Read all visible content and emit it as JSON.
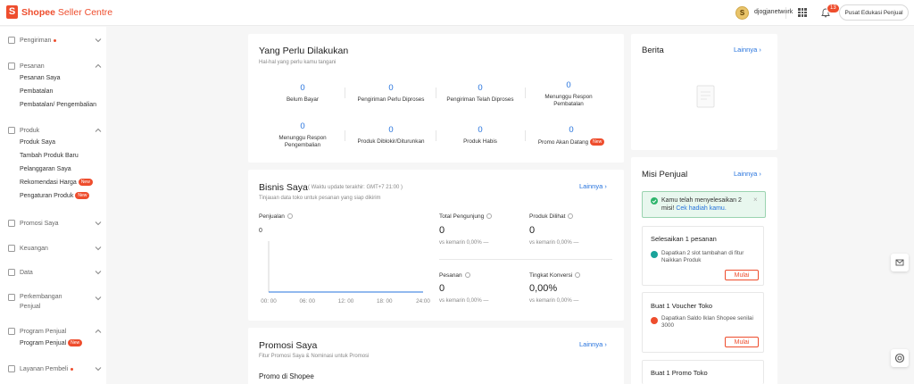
{
  "header": {
    "brand_logo_letter": "S",
    "brand_main": "Shopee",
    "brand_sub": "Seller Centre",
    "avatar_letter": "S",
    "username": "djogjanetwork",
    "notification_count": "13",
    "edu_button_label": "Pusat Edukasi Penjual"
  },
  "sidebar": {
    "groups": [
      {
        "label": "Pengiriman",
        "dot": true,
        "icon": "truck-icon",
        "items": []
      },
      {
        "label": "Pesanan",
        "icon": "clipboard-icon",
        "items": [
          {
            "label": "Pesanan Saya"
          },
          {
            "label": "Pembatalan"
          },
          {
            "label": "Pembatalan/ Pengembalian"
          }
        ]
      },
      {
        "label": "Produk",
        "icon": "box-icon",
        "items": [
          {
            "label": "Produk Saya"
          },
          {
            "label": "Tambah Produk Baru"
          },
          {
            "label": "Pelanggaran Saya"
          },
          {
            "label": "Rekomendasi Harga",
            "badge": "New"
          },
          {
            "label": "Pengaturan Produk",
            "badge": "New"
          }
        ]
      },
      {
        "label": "Promosi Saya",
        "icon": "tag-icon",
        "items": []
      },
      {
        "label": "Keuangan",
        "icon": "wallet-icon",
        "items": []
      },
      {
        "label": "Data",
        "icon": "chart-icon",
        "items": []
      },
      {
        "label": "Perkembangan Penjual",
        "icon": "growth-icon",
        "items": []
      },
      {
        "label": "Program Penjual",
        "icon": "program-icon",
        "items": [
          {
            "label": "Program Penjual",
            "badge": "New"
          }
        ]
      },
      {
        "label": "Layanan Pembeli",
        "dot": true,
        "icon": "headset-icon",
        "items": []
      }
    ]
  },
  "todo": {
    "title": "Yang Perlu Dilakukan",
    "subtitle": "Hal-hal yang perlu kamu tangani",
    "stats_row1": [
      {
        "value": "0",
        "label": "Belum Bayar"
      },
      {
        "value": "0",
        "label": "Pengiriman Perlu Diproses"
      },
      {
        "value": "0",
        "label": "Pengiriman Telah Diproses"
      },
      {
        "value": "0",
        "label": "Menunggu Respon Pembatalan"
      }
    ],
    "stats_row2": [
      {
        "value": "0",
        "label": "Menunggu Respon Pengembalian"
      },
      {
        "value": "0",
        "label": "Produk Diblokir/Diturunkan"
      },
      {
        "value": "0",
        "label": "Produk Habis"
      },
      {
        "value": "0",
        "label": "Promo Akan Datang",
        "badge": "New"
      }
    ]
  },
  "business": {
    "title": "Bisnis Saya",
    "update_note": "( Waktu update terakhir: GMT+7 21:00 )",
    "more_label": "Lainnya",
    "subtitle": "Tinjauan data toko untuk pesanan yang siap dikirim",
    "sales_label": "Penjualan",
    "metrics": [
      {
        "label": "Total Pengunjung",
        "value": "0",
        "sub": "vs kemarin 0,00% —"
      },
      {
        "label": "Produk Dilihat",
        "value": "0",
        "sub": "vs kemarin 0,00% —"
      },
      {
        "label": "Pesanan",
        "value": "0",
        "sub": "vs kemarin 0,00% —"
      },
      {
        "label": "Tingkat Konversi",
        "value": "0,00%",
        "sub": "vs kemarin 0,00% —"
      }
    ]
  },
  "chart_data": {
    "type": "line",
    "title": "",
    "xlabel": "",
    "ylabel": "",
    "categories": [
      "00: 00",
      "06: 00",
      "12: 00",
      "18: 00",
      "24:00"
    ],
    "values": [
      0,
      0,
      0,
      0,
      0
    ],
    "ytick": "0",
    "ylim": [
      0,
      1
    ],
    "grid": false,
    "line_color": "#2673dd"
  },
  "promo": {
    "title": "Promosi Saya",
    "more_label": "Lainnya",
    "subtitle": "Fitur Promosi Saya & Nominasi untuk Promosi",
    "section_label": "Promo di Shopee"
  },
  "news": {
    "title": "Berita",
    "more_label": "Lainnya"
  },
  "missions": {
    "title": "Misi Penjual",
    "more_label": "Lainnya",
    "success_text": "Kamu telah menyelesaikan 2 misi!",
    "success_link": "Cek hadiah kamu.",
    "items": [
      {
        "title": "Selesaikan 1 pesanan",
        "desc": "Dapatkan 2 slot tambahan di fitur Naikkan Produk",
        "button": "Mulai"
      },
      {
        "title": "Buat 1 Voucher Toko",
        "desc": "Dapatkan Saldo Iklan Shopee senilai 3000",
        "button": "Mulai"
      },
      {
        "title": "Buat 1 Promo Toko"
      }
    ]
  },
  "colors": {
    "brand": "#ee4d2d",
    "link": "#2673dd",
    "success_bg": "#e8f7ee",
    "success_border": "#9ad3b0"
  }
}
